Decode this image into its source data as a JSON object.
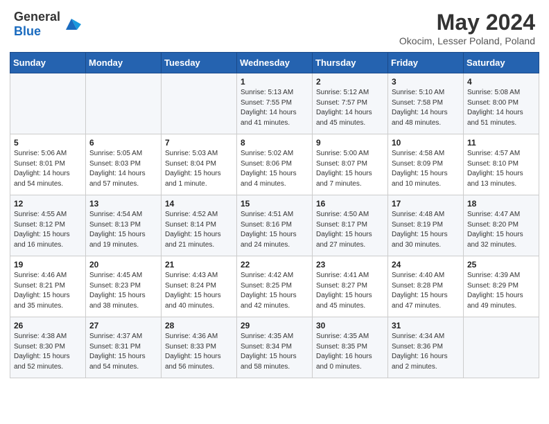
{
  "header": {
    "logo_general": "General",
    "logo_blue": "Blue",
    "title": "May 2024",
    "subtitle": "Okocim, Lesser Poland, Poland"
  },
  "weekdays": [
    "Sunday",
    "Monday",
    "Tuesday",
    "Wednesday",
    "Thursday",
    "Friday",
    "Saturday"
  ],
  "weeks": [
    [
      {
        "day": "",
        "sunrise": "",
        "sunset": "",
        "daylight": ""
      },
      {
        "day": "",
        "sunrise": "",
        "sunset": "",
        "daylight": ""
      },
      {
        "day": "",
        "sunrise": "",
        "sunset": "",
        "daylight": ""
      },
      {
        "day": "1",
        "sunrise": "Sunrise: 5:13 AM",
        "sunset": "Sunset: 7:55 PM",
        "daylight": "Daylight: 14 hours and 41 minutes."
      },
      {
        "day": "2",
        "sunrise": "Sunrise: 5:12 AM",
        "sunset": "Sunset: 7:57 PM",
        "daylight": "Daylight: 14 hours and 45 minutes."
      },
      {
        "day": "3",
        "sunrise": "Sunrise: 5:10 AM",
        "sunset": "Sunset: 7:58 PM",
        "daylight": "Daylight: 14 hours and 48 minutes."
      },
      {
        "day": "4",
        "sunrise": "Sunrise: 5:08 AM",
        "sunset": "Sunset: 8:00 PM",
        "daylight": "Daylight: 14 hours and 51 minutes."
      }
    ],
    [
      {
        "day": "5",
        "sunrise": "Sunrise: 5:06 AM",
        "sunset": "Sunset: 8:01 PM",
        "daylight": "Daylight: 14 hours and 54 minutes."
      },
      {
        "day": "6",
        "sunrise": "Sunrise: 5:05 AM",
        "sunset": "Sunset: 8:03 PM",
        "daylight": "Daylight: 14 hours and 57 minutes."
      },
      {
        "day": "7",
        "sunrise": "Sunrise: 5:03 AM",
        "sunset": "Sunset: 8:04 PM",
        "daylight": "Daylight: 15 hours and 1 minute."
      },
      {
        "day": "8",
        "sunrise": "Sunrise: 5:02 AM",
        "sunset": "Sunset: 8:06 PM",
        "daylight": "Daylight: 15 hours and 4 minutes."
      },
      {
        "day": "9",
        "sunrise": "Sunrise: 5:00 AM",
        "sunset": "Sunset: 8:07 PM",
        "daylight": "Daylight: 15 hours and 7 minutes."
      },
      {
        "day": "10",
        "sunrise": "Sunrise: 4:58 AM",
        "sunset": "Sunset: 8:09 PM",
        "daylight": "Daylight: 15 hours and 10 minutes."
      },
      {
        "day": "11",
        "sunrise": "Sunrise: 4:57 AM",
        "sunset": "Sunset: 8:10 PM",
        "daylight": "Daylight: 15 hours and 13 minutes."
      }
    ],
    [
      {
        "day": "12",
        "sunrise": "Sunrise: 4:55 AM",
        "sunset": "Sunset: 8:12 PM",
        "daylight": "Daylight: 15 hours and 16 minutes."
      },
      {
        "day": "13",
        "sunrise": "Sunrise: 4:54 AM",
        "sunset": "Sunset: 8:13 PM",
        "daylight": "Daylight: 15 hours and 19 minutes."
      },
      {
        "day": "14",
        "sunrise": "Sunrise: 4:52 AM",
        "sunset": "Sunset: 8:14 PM",
        "daylight": "Daylight: 15 hours and 21 minutes."
      },
      {
        "day": "15",
        "sunrise": "Sunrise: 4:51 AM",
        "sunset": "Sunset: 8:16 PM",
        "daylight": "Daylight: 15 hours and 24 minutes."
      },
      {
        "day": "16",
        "sunrise": "Sunrise: 4:50 AM",
        "sunset": "Sunset: 8:17 PM",
        "daylight": "Daylight: 15 hours and 27 minutes."
      },
      {
        "day": "17",
        "sunrise": "Sunrise: 4:48 AM",
        "sunset": "Sunset: 8:19 PM",
        "daylight": "Daylight: 15 hours and 30 minutes."
      },
      {
        "day": "18",
        "sunrise": "Sunrise: 4:47 AM",
        "sunset": "Sunset: 8:20 PM",
        "daylight": "Daylight: 15 hours and 32 minutes."
      }
    ],
    [
      {
        "day": "19",
        "sunrise": "Sunrise: 4:46 AM",
        "sunset": "Sunset: 8:21 PM",
        "daylight": "Daylight: 15 hours and 35 minutes."
      },
      {
        "day": "20",
        "sunrise": "Sunrise: 4:45 AM",
        "sunset": "Sunset: 8:23 PM",
        "daylight": "Daylight: 15 hours and 38 minutes."
      },
      {
        "day": "21",
        "sunrise": "Sunrise: 4:43 AM",
        "sunset": "Sunset: 8:24 PM",
        "daylight": "Daylight: 15 hours and 40 minutes."
      },
      {
        "day": "22",
        "sunrise": "Sunrise: 4:42 AM",
        "sunset": "Sunset: 8:25 PM",
        "daylight": "Daylight: 15 hours and 42 minutes."
      },
      {
        "day": "23",
        "sunrise": "Sunrise: 4:41 AM",
        "sunset": "Sunset: 8:27 PM",
        "daylight": "Daylight: 15 hours and 45 minutes."
      },
      {
        "day": "24",
        "sunrise": "Sunrise: 4:40 AM",
        "sunset": "Sunset: 8:28 PM",
        "daylight": "Daylight: 15 hours and 47 minutes."
      },
      {
        "day": "25",
        "sunrise": "Sunrise: 4:39 AM",
        "sunset": "Sunset: 8:29 PM",
        "daylight": "Daylight: 15 hours and 49 minutes."
      }
    ],
    [
      {
        "day": "26",
        "sunrise": "Sunrise: 4:38 AM",
        "sunset": "Sunset: 8:30 PM",
        "daylight": "Daylight: 15 hours and 52 minutes."
      },
      {
        "day": "27",
        "sunrise": "Sunrise: 4:37 AM",
        "sunset": "Sunset: 8:31 PM",
        "daylight": "Daylight: 15 hours and 54 minutes."
      },
      {
        "day": "28",
        "sunrise": "Sunrise: 4:36 AM",
        "sunset": "Sunset: 8:33 PM",
        "daylight": "Daylight: 15 hours and 56 minutes."
      },
      {
        "day": "29",
        "sunrise": "Sunrise: 4:35 AM",
        "sunset": "Sunset: 8:34 PM",
        "daylight": "Daylight: 15 hours and 58 minutes."
      },
      {
        "day": "30",
        "sunrise": "Sunrise: 4:35 AM",
        "sunset": "Sunset: 8:35 PM",
        "daylight": "Daylight: 16 hours and 0 minutes."
      },
      {
        "day": "31",
        "sunrise": "Sunrise: 4:34 AM",
        "sunset": "Sunset: 8:36 PM",
        "daylight": "Daylight: 16 hours and 2 minutes."
      },
      {
        "day": "",
        "sunrise": "",
        "sunset": "",
        "daylight": ""
      }
    ]
  ]
}
